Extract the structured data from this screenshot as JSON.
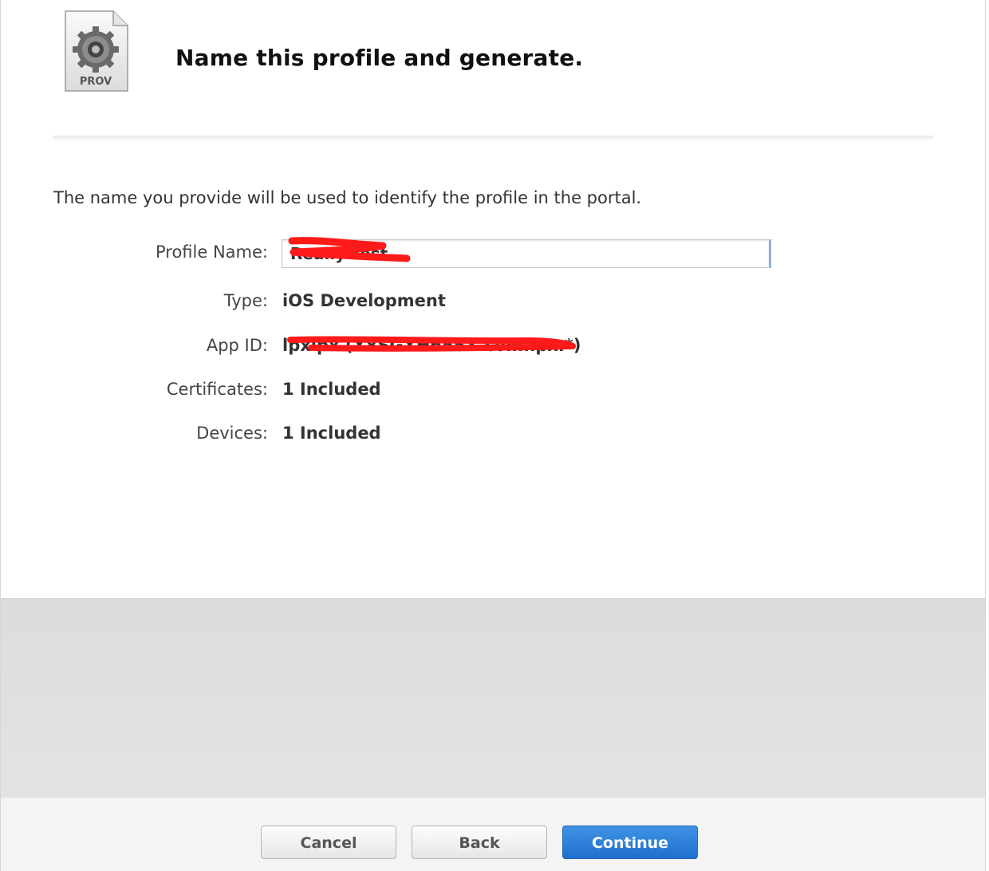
{
  "header": {
    "icon_label": "PROV",
    "icon": "gear-icon",
    "title": "Name this profile and generate."
  },
  "intro_text": "The name you provide will be used to identify the profile in the portal.",
  "form": {
    "profile_name_label": "Profile Name:",
    "profile_name_value": "Really Test",
    "type_label": "Type:",
    "type_value": "iOS Development",
    "app_id_label": "App ID:",
    "app_id_value": "lpxlpx (X8SGXH655X.com.lpx.*)",
    "certificates_label": "Certificates:",
    "certificates_value": "1 Included",
    "devices_label": "Devices:",
    "devices_value": "1 Included"
  },
  "footer": {
    "cancel_label": "Cancel",
    "back_label": "Back",
    "continue_label": "Continue"
  },
  "colors": {
    "primary_button": "#2a7ad6",
    "redaction": "#ff1a1a"
  }
}
